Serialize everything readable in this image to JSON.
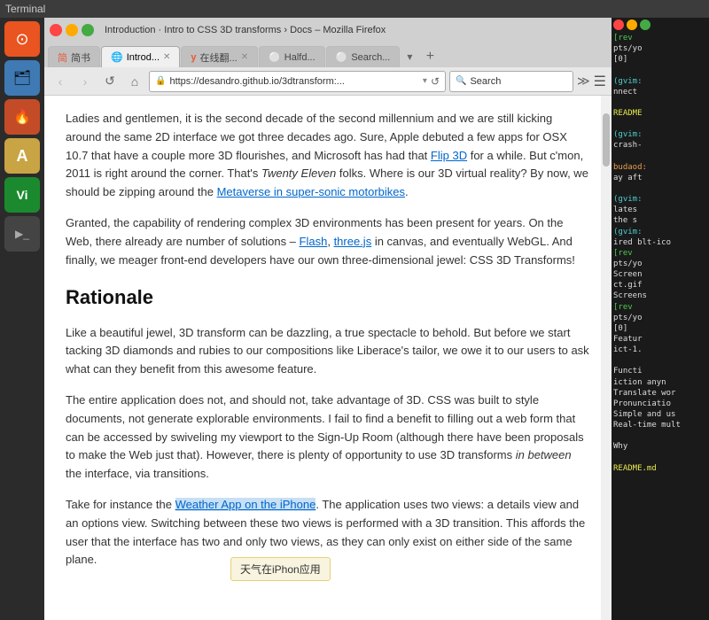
{
  "terminal_titlebar": "Terminal",
  "browser": {
    "title": "Introduction · Intro to CSS 3D transforms › Docs – Mozilla Firefox",
    "tabs": [
      {
        "label": "简书",
        "icon": "📖",
        "active": false,
        "closeable": false
      },
      {
        "label": "Introd...",
        "icon": "🌐",
        "active": true,
        "closeable": true
      },
      {
        "label": "y 在线翻...",
        "icon": "y",
        "active": false,
        "closeable": true
      },
      {
        "label": "Halfd...",
        "icon": "⭕",
        "active": false,
        "closeable": false
      },
      {
        "label": "Search...",
        "icon": "⭕",
        "active": false,
        "closeable": false
      }
    ],
    "url": "https://desandro.github.io/3dtransform:...",
    "search_placeholder": "Search",
    "article": {
      "paragraph1": "Ladies and gentlemen, it is the second decade of the second millennium and we are still kicking around the same 2D interface we got three decades ago. Sure, Apple debuted a few apps for OSX 10.7 that have a couple more 3D flourishes, and Microsoft has had that ",
      "flip3d_link": "Flip 3D",
      "paragraph1_cont": " for a while. But c'mon, 2011 is right around the corner. That's ",
      "twenty_eleven": "Twenty Eleven",
      "paragraph1_cont2": " folks. Where is our 3D virtual reality? By now, we should be zipping around the ",
      "metaverse_link": "Metaverse in super-sonic motorbikes",
      "paragraph1_end": ".",
      "paragraph2": "Granted, the capability of rendering complex 3D environments has been present for years. On the Web, there already are number of solutions – ",
      "flash_link": "Flash",
      "paragraph2_mid": ", ",
      "threejs_link": "three.js",
      "paragraph2_cont": " in canvas, and eventually WebGL. And finally, we meager front-end developers have our own three-dimensional jewel: CSS 3D Transforms!",
      "rationale_heading": "Rationale",
      "paragraph3": "Like a beautiful jewel, 3D transform can be dazzling, a true spectacle to behold. But before we start tacking 3D diamonds and rubies to our compositions like Liberace's tailor, we owe it to our users to ask what can they benefit from this awesome feature.",
      "paragraph4": "The entire application does not, and should not, take advantage of 3D. CSS was built to style documents, not generate explorable environments. I fail to find a benefit to filling out a web form that can be accessed by swiveling my viewport to the Sign-Up Room (although there have been proposals to make the Web just that). However, there is plenty of opportunity to use 3D transforms ",
      "in_between_italic": "in between",
      "paragraph4_cont": " the interface, via transitions.",
      "paragraph5": "Take for instance the ",
      "weather_app_link": "Weather App on the iPhone",
      "paragraph5_cont": ". The application uses two views: a details view and an options view. Switching between these two views is performed with a 3D transition. This affords the user that the interface has two and only two views, as they can only exist on either side of the same plane.",
      "tooltip_text": "天气在iPhon应用"
    }
  },
  "terminal": {
    "lines": [
      {
        "text": "[rev",
        "class": "t-green"
      },
      {
        "text": "pts/yo",
        "class": "t-white"
      },
      {
        "text": "[0]",
        "class": "t-white"
      },
      {
        "text": "",
        "class": "t-white"
      },
      {
        "text": "(gvim:",
        "class": "t-cyan"
      },
      {
        "text": "nnect",
        "class": "t-white"
      },
      {
        "text": "",
        "class": "t-white"
      },
      {
        "text": "README",
        "class": "t-yellow"
      },
      {
        "text": "",
        "class": "t-white"
      },
      {
        "text": "(gvim:",
        "class": "t-cyan"
      },
      {
        "text": "crash-",
        "class": "t-white"
      },
      {
        "text": "",
        "class": "t-white"
      },
      {
        "text": "budaod:",
        "class": "t-orange"
      },
      {
        "text": "ay aft",
        "class": "t-white"
      },
      {
        "text": "",
        "class": "t-white"
      },
      {
        "text": "(gvim:",
        "class": "t-cyan"
      },
      {
        "text": "lates",
        "class": "t-white"
      },
      {
        "text": "",
        "class": "t-white"
      },
      {
        "text": "the s",
        "class": "t-white"
      },
      {
        "text": "(gvim:",
        "class": "t-cyan"
      },
      {
        "text": "ired blt-ico",
        "class": "t-white"
      },
      {
        "text": "[rev",
        "class": "t-green"
      },
      {
        "text": "pts/yo",
        "class": "t-white"
      },
      {
        "text": "Screen",
        "class": "t-white"
      },
      {
        "text": "ct.gif",
        "class": "t-white"
      },
      {
        "text": "Screens",
        "class": "t-white"
      },
      {
        "text": "[rev",
        "class": "t-green"
      },
      {
        "text": "pts/yo",
        "class": "t-white"
      },
      {
        "text": "[0]",
        "class": "t-white"
      },
      {
        "text": "Featur",
        "class": "t-white"
      },
      {
        "text": "ict-1.",
        "class": "t-white"
      },
      {
        "text": "",
        "class": "t-white"
      },
      {
        "text": "Functi",
        "class": "t-white"
      },
      {
        "text": "iction anyn",
        "class": "t-white"
      },
      {
        "text": "Translate wor",
        "class": "t-white"
      },
      {
        "text": "Pronunciatio",
        "class": "t-white"
      },
      {
        "text": "Simple and us",
        "class": "t-white"
      },
      {
        "text": "Real-time mult",
        "class": "t-white"
      },
      {
        "text": "",
        "class": "t-white"
      },
      {
        "text": "Why",
        "class": "t-white"
      },
      {
        "text": "",
        "class": "t-white"
      },
      {
        "text": "README.md",
        "class": "t-yellow"
      }
    ]
  },
  "taskbar": {
    "icons": [
      {
        "name": "ubuntu",
        "symbol": "🔴"
      },
      {
        "name": "files",
        "symbol": "📁"
      },
      {
        "name": "firefox",
        "symbol": "🦊"
      },
      {
        "name": "fonts",
        "symbol": "A"
      },
      {
        "name": "vim",
        "symbol": "V"
      },
      {
        "name": "terminal",
        "symbol": ">_"
      }
    ]
  }
}
